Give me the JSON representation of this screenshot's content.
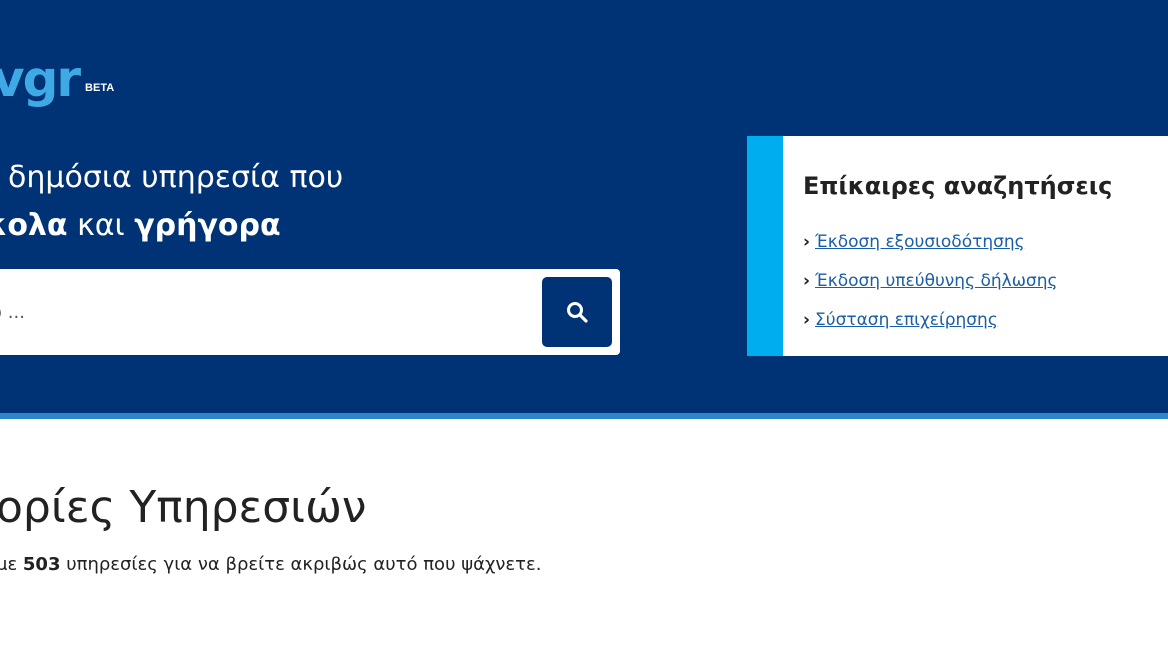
{
  "logo": {
    "text": "vgr",
    "badge": "BETA"
  },
  "hero": {
    "title_line1": "δημόσια υπηρεσία που",
    "title_line2_bold1": "κολα",
    "title_line2_mid": " και ",
    "title_line2_bold2": "γρήγορα"
  },
  "search": {
    "placeholder": "δώ ...",
    "button_icon": "search-icon"
  },
  "trending": {
    "title": "Επίκαιρες αναζητήσεις",
    "links": [
      "Έκδοση εξουσιοδότησης",
      "Έκδοση υπεύθυνης δήλωσης",
      "Σύσταση επιχείρησης"
    ]
  },
  "categories": {
    "title": "ορίες Υπηρεσιών",
    "subtitle_prefix": "με ",
    "count": "503",
    "subtitle_suffix": " υπηρεσίες για να βρείτε ακριβώς αυτό που ψάχνετε."
  },
  "colors": {
    "hero_bg": "#003375",
    "accent": "#00aeef",
    "link": "#1a5ea8",
    "logo_accent": "#3fa9e5"
  }
}
